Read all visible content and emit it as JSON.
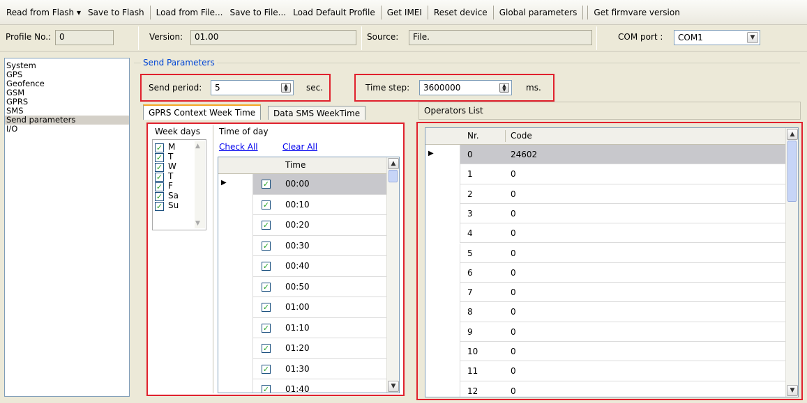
{
  "toolbar": {
    "items": [
      "Read from Flash",
      "Save to Flash",
      "Load from File...",
      "Save to File...",
      "Load Default Profile",
      "Get IMEI",
      "Reset device",
      "Global parameters",
      "Get firmvare version"
    ]
  },
  "info": {
    "profile_label": "Profile No.:",
    "profile_value": "0",
    "version_label": "Version:",
    "version_value": "01.00",
    "source_label": "Source:",
    "source_value": "File.",
    "com_label": "COM port :",
    "com_value": "COM1"
  },
  "nav": {
    "items": [
      "System",
      "GPS",
      "Geofence",
      "GSM",
      "GPRS",
      "SMS",
      "Send parameters",
      "I/O"
    ],
    "selected": 6
  },
  "group": {
    "title": "Send Parameters"
  },
  "send_period": {
    "label": "Send period:",
    "value": "5",
    "unit": "sec."
  },
  "time_step": {
    "label": "Time step:",
    "value": "3600000",
    "unit": "ms."
  },
  "tabs": [
    "GPRS Context Week Time",
    "Data SMS WeekTime"
  ],
  "week": {
    "header": "Week days",
    "days": [
      "M",
      "T",
      "W",
      "T",
      "F",
      "Sa",
      "Su"
    ]
  },
  "tod": {
    "header": "Time of day",
    "check_all": "Check All",
    "clear_all": "Clear All",
    "col_time": "Time",
    "times": [
      "00:00",
      "00:10",
      "00:20",
      "00:30",
      "00:40",
      "00:50",
      "01:00",
      "01:10",
      "01:20",
      "01:30",
      "01:40"
    ]
  },
  "operators": {
    "title": "Operators List",
    "col_nr": "Nr.",
    "col_code": "Code",
    "rows": [
      {
        "nr": "0",
        "code": "24602"
      },
      {
        "nr": "1",
        "code": "0"
      },
      {
        "nr": "2",
        "code": "0"
      },
      {
        "nr": "3",
        "code": "0"
      },
      {
        "nr": "4",
        "code": "0"
      },
      {
        "nr": "5",
        "code": "0"
      },
      {
        "nr": "6",
        "code": "0"
      },
      {
        "nr": "7",
        "code": "0"
      },
      {
        "nr": "8",
        "code": "0"
      },
      {
        "nr": "9",
        "code": "0"
      },
      {
        "nr": "10",
        "code": "0"
      },
      {
        "nr": "11",
        "code": "0"
      },
      {
        "nr": "12",
        "code": "0"
      }
    ]
  },
  "colors": {
    "highlight": "#e0212d",
    "link": "#0000ee",
    "group_title": "#0046d5",
    "check": "#21a121"
  }
}
